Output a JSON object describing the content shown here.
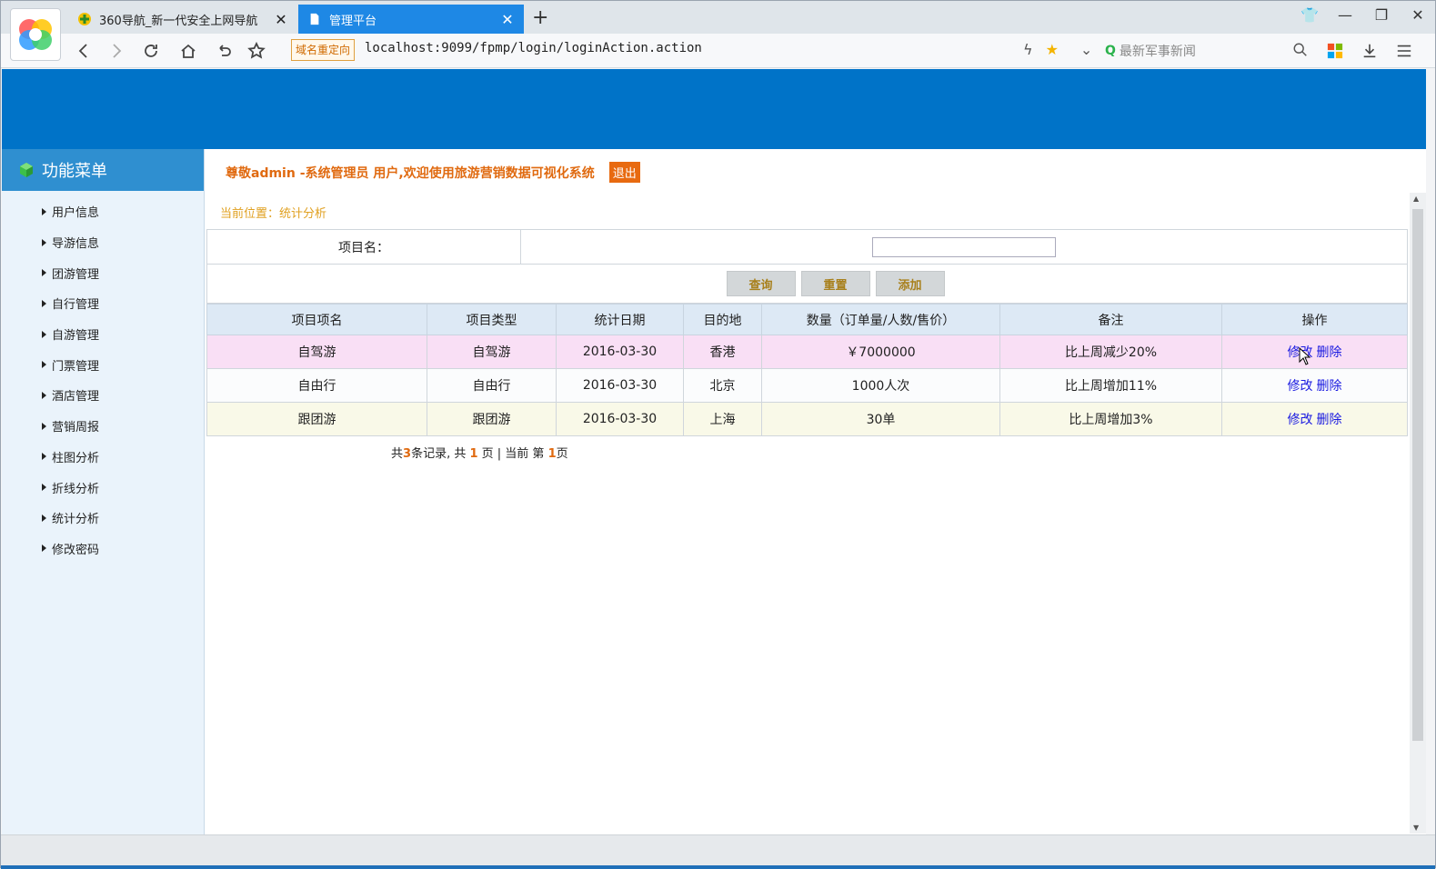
{
  "browser": {
    "tabs": [
      {
        "label": "360导航_新一代安全上网导航",
        "icon": "360-nav-icon",
        "active": false
      },
      {
        "label": "管理平台",
        "icon": "document-icon",
        "active": true
      }
    ],
    "redirect_badge": "域名重定向",
    "url": "localhost:9099/fpmp/login/loginAction.action",
    "search_placeholder": "最新军事新闻"
  },
  "sidebar": {
    "title": "功能菜单",
    "items": [
      {
        "label": "用户信息"
      },
      {
        "label": "导游信息"
      },
      {
        "label": "团游管理"
      },
      {
        "label": "自行管理"
      },
      {
        "label": "自游管理"
      },
      {
        "label": "门票管理"
      },
      {
        "label": "酒店管理"
      },
      {
        "label": "营销周报"
      },
      {
        "label": "柱图分析"
      },
      {
        "label": "折线分析"
      },
      {
        "label": "统计分析"
      },
      {
        "label": "修改密码"
      }
    ]
  },
  "header": {
    "welcome": "尊敬admin -系统管理员 用户,欢迎使用旅游营销数据可视化系统",
    "logout": "退出",
    "breadcrumb": "当前位置：统计分析"
  },
  "search": {
    "label": "项目名：",
    "value": "",
    "buttons": {
      "query": "查询",
      "reset": "重置",
      "add": "添加"
    }
  },
  "table": {
    "headers": [
      "项目项名",
      "项目类型",
      "统计日期",
      "目的地",
      "数量（订单量/人数/售价）",
      "备注",
      "操作"
    ],
    "rows": [
      {
        "name": "自驾游",
        "type": "自驾游",
        "date": "2016-03-30",
        "dest": "香港",
        "qty": "￥7000000",
        "note": "比上周减少20%",
        "edit": "修改",
        "del": "删除"
      },
      {
        "name": "自由行",
        "type": "自由行",
        "date": "2016-03-30",
        "dest": "北京",
        "qty": "1000人次",
        "note": "比上周增加11%",
        "edit": "修改",
        "del": "删除"
      },
      {
        "name": "跟团游",
        "type": "跟团游",
        "date": "2016-03-30",
        "dest": "上海",
        "qty": "30单",
        "note": "比上周增加3%",
        "edit": "修改",
        "del": "删除"
      }
    ]
  },
  "pager": {
    "t1": "共",
    "total": "3",
    "t2": "条记录, 共 ",
    "pages": "1",
    "t3": " 页 | 当前 第 ",
    "current": "1",
    "t4": "页"
  },
  "colors": {
    "banner": "#0073c8",
    "active_tab": "#1e88e5",
    "accent": "#e06a10",
    "link": "#1a1ae0"
  }
}
